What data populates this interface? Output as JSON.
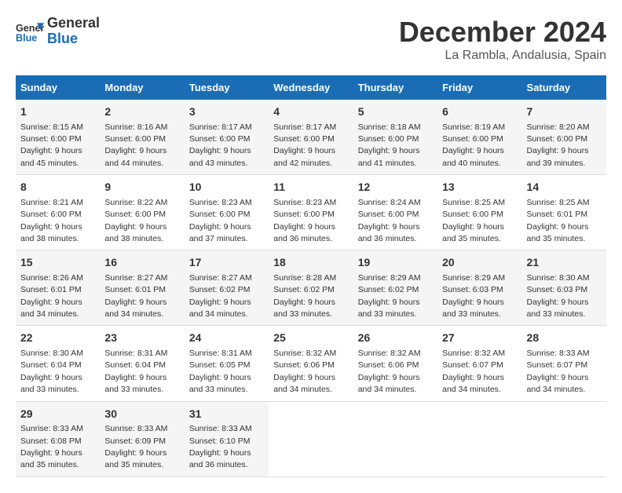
{
  "logo": {
    "line1": "General",
    "line2": "Blue"
  },
  "title": "December 2024",
  "location": "La Rambla, Andalusia, Spain",
  "days_of_week": [
    "Sunday",
    "Monday",
    "Tuesday",
    "Wednesday",
    "Thursday",
    "Friday",
    "Saturday"
  ],
  "weeks": [
    [
      {
        "day": "1",
        "sunrise": "8:15 AM",
        "sunset": "6:00 PM",
        "daylight": "9 hours and 45 minutes."
      },
      {
        "day": "2",
        "sunrise": "8:16 AM",
        "sunset": "6:00 PM",
        "daylight": "9 hours and 44 minutes."
      },
      {
        "day": "3",
        "sunrise": "8:17 AM",
        "sunset": "6:00 PM",
        "daylight": "9 hours and 43 minutes."
      },
      {
        "day": "4",
        "sunrise": "8:17 AM",
        "sunset": "6:00 PM",
        "daylight": "9 hours and 42 minutes."
      },
      {
        "day": "5",
        "sunrise": "8:18 AM",
        "sunset": "6:00 PM",
        "daylight": "9 hours and 41 minutes."
      },
      {
        "day": "6",
        "sunrise": "8:19 AM",
        "sunset": "6:00 PM",
        "daylight": "9 hours and 40 minutes."
      },
      {
        "day": "7",
        "sunrise": "8:20 AM",
        "sunset": "6:00 PM",
        "daylight": "9 hours and 39 minutes."
      }
    ],
    [
      {
        "day": "8",
        "sunrise": "8:21 AM",
        "sunset": "6:00 PM",
        "daylight": "9 hours and 38 minutes."
      },
      {
        "day": "9",
        "sunrise": "8:22 AM",
        "sunset": "6:00 PM",
        "daylight": "9 hours and 38 minutes."
      },
      {
        "day": "10",
        "sunrise": "8:23 AM",
        "sunset": "6:00 PM",
        "daylight": "9 hours and 37 minutes."
      },
      {
        "day": "11",
        "sunrise": "8:23 AM",
        "sunset": "6:00 PM",
        "daylight": "9 hours and 36 minutes."
      },
      {
        "day": "12",
        "sunrise": "8:24 AM",
        "sunset": "6:00 PM",
        "daylight": "9 hours and 36 minutes."
      },
      {
        "day": "13",
        "sunrise": "8:25 AM",
        "sunset": "6:00 PM",
        "daylight": "9 hours and 35 minutes."
      },
      {
        "day": "14",
        "sunrise": "8:25 AM",
        "sunset": "6:01 PM",
        "daylight": "9 hours and 35 minutes."
      }
    ],
    [
      {
        "day": "15",
        "sunrise": "8:26 AM",
        "sunset": "6:01 PM",
        "daylight": "9 hours and 34 minutes."
      },
      {
        "day": "16",
        "sunrise": "8:27 AM",
        "sunset": "6:01 PM",
        "daylight": "9 hours and 34 minutes."
      },
      {
        "day": "17",
        "sunrise": "8:27 AM",
        "sunset": "6:02 PM",
        "daylight": "9 hours and 34 minutes."
      },
      {
        "day": "18",
        "sunrise": "8:28 AM",
        "sunset": "6:02 PM",
        "daylight": "9 hours and 33 minutes."
      },
      {
        "day": "19",
        "sunrise": "8:29 AM",
        "sunset": "6:02 PM",
        "daylight": "9 hours and 33 minutes."
      },
      {
        "day": "20",
        "sunrise": "8:29 AM",
        "sunset": "6:03 PM",
        "daylight": "9 hours and 33 minutes."
      },
      {
        "day": "21",
        "sunrise": "8:30 AM",
        "sunset": "6:03 PM",
        "daylight": "9 hours and 33 minutes."
      }
    ],
    [
      {
        "day": "22",
        "sunrise": "8:30 AM",
        "sunset": "6:04 PM",
        "daylight": "9 hours and 33 minutes."
      },
      {
        "day": "23",
        "sunrise": "8:31 AM",
        "sunset": "6:04 PM",
        "daylight": "9 hours and 33 minutes."
      },
      {
        "day": "24",
        "sunrise": "8:31 AM",
        "sunset": "6:05 PM",
        "daylight": "9 hours and 33 minutes."
      },
      {
        "day": "25",
        "sunrise": "8:32 AM",
        "sunset": "6:06 PM",
        "daylight": "9 hours and 34 minutes."
      },
      {
        "day": "26",
        "sunrise": "8:32 AM",
        "sunset": "6:06 PM",
        "daylight": "9 hours and 34 minutes."
      },
      {
        "day": "27",
        "sunrise": "8:32 AM",
        "sunset": "6:07 PM",
        "daylight": "9 hours and 34 minutes."
      },
      {
        "day": "28",
        "sunrise": "8:33 AM",
        "sunset": "6:07 PM",
        "daylight": "9 hours and 34 minutes."
      }
    ],
    [
      {
        "day": "29",
        "sunrise": "8:33 AM",
        "sunset": "6:08 PM",
        "daylight": "9 hours and 35 minutes."
      },
      {
        "day": "30",
        "sunrise": "8:33 AM",
        "sunset": "6:09 PM",
        "daylight": "9 hours and 35 minutes."
      },
      {
        "day": "31",
        "sunrise": "8:33 AM",
        "sunset": "6:10 PM",
        "daylight": "9 hours and 36 minutes."
      },
      null,
      null,
      null,
      null
    ]
  ],
  "labels": {
    "sunrise_label": "Sunrise:",
    "sunset_label": "Sunset:",
    "daylight_label": "Daylight:"
  }
}
